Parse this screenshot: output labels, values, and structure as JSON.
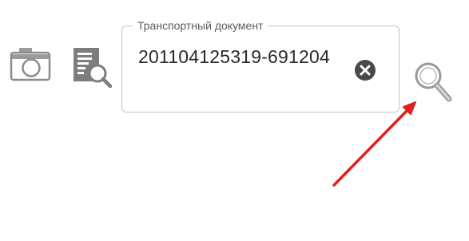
{
  "toolbar": {
    "camera_icon": "camera-icon",
    "doc_search_icon": "document-search-icon",
    "search_icon": "search-icon"
  },
  "field": {
    "label": "Транспортный документ",
    "value": "201104125319-691204",
    "clear_icon": "clear-icon"
  },
  "colors": {
    "icon_gray": "#8c8c8c",
    "border": "#c4c4c4",
    "annotation_arrow": "#e02020"
  }
}
